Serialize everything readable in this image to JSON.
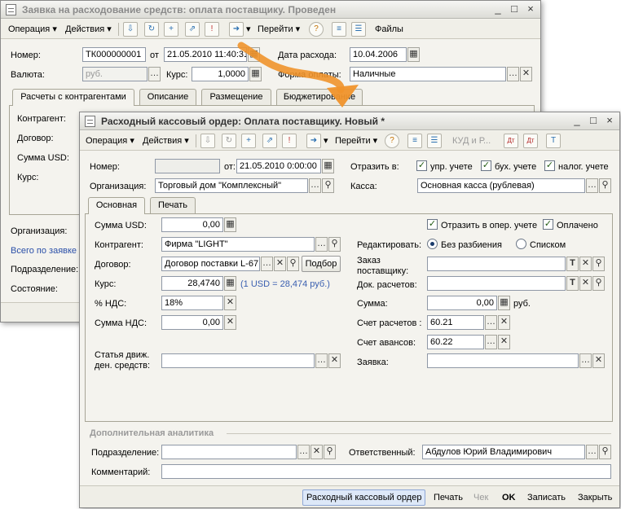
{
  "colors": {
    "arrow": "#f0932b",
    "link": "#2a4fa8",
    "window_bg": "#f4f3ee"
  },
  "win1": {
    "title": "Заявка на расходование средств: оплата поставщику. Проведен",
    "toolbar": {
      "operation": "Операция",
      "actions": "Действия",
      "goto": "Перейти",
      "files": "Файлы"
    },
    "number_label": "Номер:",
    "number_value": "ТК000000001",
    "from_label": "от",
    "date_value": "21.05.2010 11:40:31",
    "expense_date_label": "Дата расхода:",
    "expense_date_value": "10.04.2006",
    "currency_label": "Валюта:",
    "currency_value": "руб.",
    "rate_label": "Курс:",
    "rate_value": "1,0000",
    "payment_form_label": "Форма оплаты:",
    "payment_form_value": "Наличные",
    "tabs": [
      "Расчеты с контрагентами",
      "Описание",
      "Размещение",
      "Бюджетирование"
    ],
    "side_labels": {
      "counterparty": "Контрагент:",
      "contract": "Договор:",
      "sum_usd": "Сумма USD:",
      "rate": "Курс:"
    },
    "organization_label": "Организация:",
    "total_link": "Всего по заявке",
    "division_label": "Подразделение:",
    "state_label": "Состояние:"
  },
  "win2": {
    "title": "Расходный кассовый ордер: Оплата поставщику. Новый *",
    "toolbar": {
      "operation": "Операция",
      "actions": "Действия",
      "goto": "Перейти",
      "kud": "КУД и Р..."
    },
    "number_label": "Номер:",
    "number_value": "",
    "from_label": "от:",
    "date_value": "21.05.2010 0:00:00",
    "reflect_label": "Отразить в:",
    "reflect_checks": [
      {
        "label": "упр. учете",
        "checked": true
      },
      {
        "label": "бух. учете",
        "checked": true
      },
      {
        "label": "налог. учете",
        "checked": true
      }
    ],
    "org_label": "Организация:",
    "org_value": "Торговый дом \"Комплексный\"",
    "cash_label": "Касса:",
    "cash_value": "Основная касса (рублевая)",
    "tabs": [
      "Основная",
      "Печать"
    ],
    "sum_usd_label": "Сумма USD:",
    "sum_usd_value": "0,00",
    "counterparty_label": "Контрагент:",
    "counterparty_value": "Фирма \"LIGHT\"",
    "contract_label": "Договор:",
    "contract_value": "Договор поставки L-67",
    "select_button": "Подбор",
    "rate_label": "Курс:",
    "rate_value": "28,4740",
    "rate_hint": "(1 USD = 28,474 руб.)",
    "vat_label": "% НДС:",
    "vat_value": "18%",
    "vat_sum_label": "Сумма НДС:",
    "vat_sum_value": "0,00",
    "cash_flow_label_1": "Статья движ.",
    "cash_flow_label_2": "ден. средств:",
    "reflect_oper_label": "Отразить в опер. учете",
    "reflect_oper_checked": true,
    "paid_label": "Оплачено",
    "paid_checked": true,
    "edit_label": "Редактировать:",
    "edit_options": [
      {
        "label": "Без разбиения",
        "selected": true
      },
      {
        "label": "Списком",
        "selected": false
      }
    ],
    "order_label_1": "Заказ",
    "order_label_2": "поставщику:",
    "settlement_doc_label": "Док. расчетов:",
    "sum_label": "Сумма:",
    "sum_value": "0,00",
    "sum_unit": "руб.",
    "account_settle_label": "Счет расчетов :",
    "account_settle_value": "60.21",
    "account_adv_label": "Счет авансов:",
    "account_adv_value": "60.22",
    "request_label": "Заявка:",
    "extra_section": "Дополнительная аналитика",
    "division_label": "Подразделение:",
    "responsible_label": "Ответственный:",
    "responsible_value": "Абдулов Юрий Владимирович",
    "comment_label": "Комментарий:",
    "footer": {
      "rko": "Расходный кассовый ордер",
      "print": "Печать",
      "check": "Чек",
      "ok": "OK",
      "save": "Записать",
      "close": "Закрыть"
    }
  }
}
